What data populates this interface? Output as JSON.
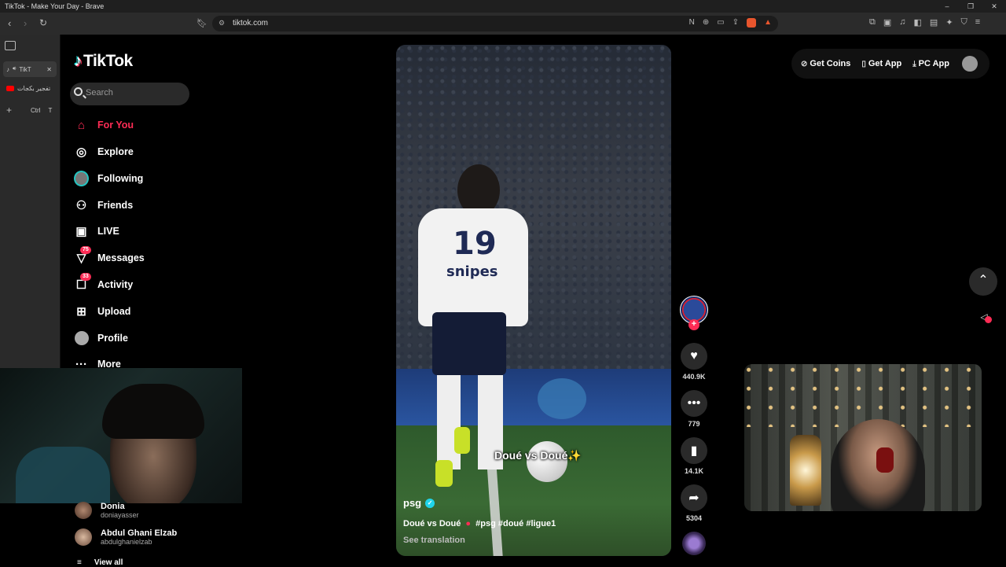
{
  "window": {
    "title": "TikTok - Make Your Day - Brave",
    "controls": [
      "–",
      "❐",
      "✕"
    ]
  },
  "browser": {
    "url": "tiktok.com",
    "tabs": [
      {
        "label": "TikT",
        "active": true
      },
      {
        "label": "تفجير بكجات",
        "active": false
      }
    ],
    "new_tab_shortcut": {
      "key1": "Ctrl",
      "key2": "T"
    }
  },
  "tiktok": {
    "logo": "TikTok",
    "search_placeholder": "Search",
    "nav": [
      {
        "label": "For You",
        "icon": "home-icon",
        "active": true
      },
      {
        "label": "Explore",
        "icon": "compass-icon"
      },
      {
        "label": "Following",
        "icon": "following-avatar-icon"
      },
      {
        "label": "Friends",
        "icon": "friends-icon"
      },
      {
        "label": "LIVE",
        "icon": "live-icon"
      },
      {
        "label": "Messages",
        "icon": "messages-icon",
        "badge": "75"
      },
      {
        "label": "Activity",
        "icon": "activity-icon",
        "badge": "33"
      },
      {
        "label": "Upload",
        "icon": "upload-icon"
      },
      {
        "label": "Profile",
        "icon": "profile-avatar-icon"
      },
      {
        "label": "More",
        "icon": "more-icon"
      }
    ],
    "following_accounts": [
      {
        "name": "Donia",
        "handle": "doniayasser"
      },
      {
        "name": "Abdul Ghani Elzab",
        "handle": "abdulghanielzab"
      }
    ],
    "view_all": "View all",
    "header": {
      "get_coins": "Get Coins",
      "get_app": "Get App",
      "pc_app": "PC App"
    },
    "video": {
      "jersey_number": "19",
      "sponsor": "snipes",
      "overlay_text": "Doué vs Doué",
      "username": "psg",
      "description_prefix": "Doué vs Doué",
      "hashtags": "#psg #doué #ligue1",
      "see_translation": "See translation"
    },
    "actions": {
      "likes": "440.9K",
      "comments": "779",
      "saves": "14.1K",
      "shares": "5304"
    }
  },
  "colors": {
    "accent": "#fe2c55",
    "verified": "#20d5ec",
    "background": "#000000"
  }
}
